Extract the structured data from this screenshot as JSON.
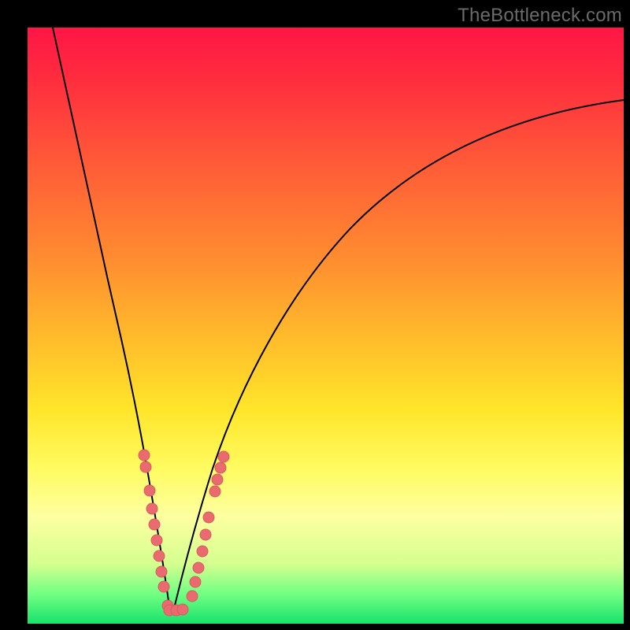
{
  "watermark": "TheBottleneck.com",
  "colors": {
    "frame": "#000000",
    "gradient_top": "#ff1646",
    "gradient_bottom": "#18e26a",
    "curve": "#000000",
    "dot": "#e96a6f"
  },
  "chart_data": {
    "type": "line",
    "title": "",
    "xlabel": "",
    "ylabel": "",
    "xlim": [
      0,
      100
    ],
    "ylim": [
      0,
      100
    ],
    "notes": "V-shaped bottleneck curve on a red→green vertical gradient; apex (best match) near x≈24. Axes are unlabeled; values estimated from pixel positions as percent of plot area (0,0 = bottom-left).",
    "series": [
      {
        "name": "left-branch",
        "x": [
          4,
          7,
          10,
          13,
          16,
          18,
          19.8,
          21,
          22,
          23,
          23.6
        ],
        "y": [
          100,
          80,
          62,
          46,
          32,
          22,
          14,
          9,
          5.5,
          3,
          2
        ]
      },
      {
        "name": "right-branch",
        "x": [
          24.4,
          25.5,
          27,
          29,
          32,
          36,
          42,
          50,
          60,
          72,
          86,
          100
        ],
        "y": [
          2,
          3.5,
          6,
          10,
          16,
          24,
          34,
          46,
          58,
          70,
          81,
          88
        ]
      }
    ],
    "apex": {
      "x": 24,
      "y": 2
    },
    "dots_left_branch": [
      {
        "x": 19.6,
        "y": 28.2
      },
      {
        "x": 19.85,
        "y": 26.2
      },
      {
        "x": 20.45,
        "y": 22.2
      },
      {
        "x": 20.9,
        "y": 19.2
      },
      {
        "x": 21.25,
        "y": 16.6
      },
      {
        "x": 21.6,
        "y": 14.0
      },
      {
        "x": 22.0,
        "y": 11.4
      },
      {
        "x": 22.4,
        "y": 8.8
      },
      {
        "x": 22.85,
        "y": 6.2
      },
      {
        "x": 23.55,
        "y": 3.0
      }
    ],
    "dots_apex": [
      {
        "x": 23.8,
        "y": 2.2
      },
      {
        "x": 24.9,
        "y": 2.2
      },
      {
        "x": 26.0,
        "y": 2.3
      }
    ],
    "dots_right_branch": [
      {
        "x": 27.6,
        "y": 4.6
      },
      {
        "x": 28.15,
        "y": 7.0
      },
      {
        "x": 28.7,
        "y": 9.4
      },
      {
        "x": 29.3,
        "y": 12.2
      },
      {
        "x": 29.85,
        "y": 15.0
      },
      {
        "x": 30.45,
        "y": 17.8
      },
      {
        "x": 31.4,
        "y": 22.2
      },
      {
        "x": 31.9,
        "y": 24.2
      },
      {
        "x": 32.4,
        "y": 26.2
      },
      {
        "x": 32.85,
        "y": 28.0
      }
    ]
  }
}
